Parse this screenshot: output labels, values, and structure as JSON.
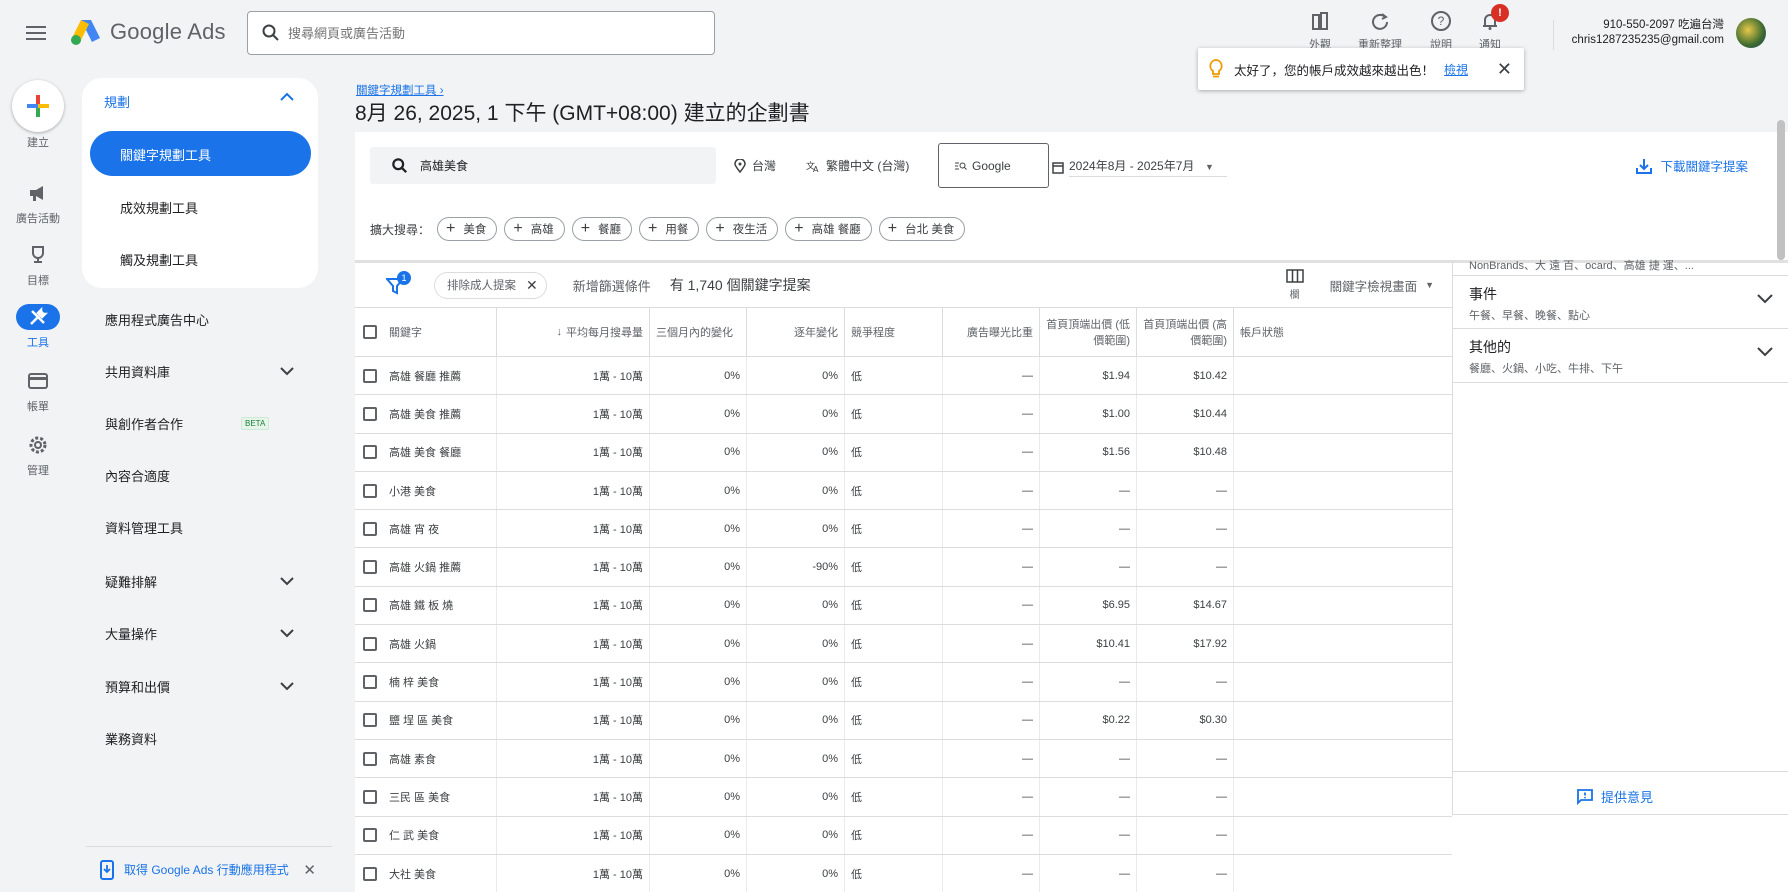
{
  "header": {
    "logo_text": "Google Ads",
    "search_placeholder": "搜尋網頁或廣告活動",
    "tools": [
      {
        "icon": "appearance-icon",
        "label": "外觀"
      },
      {
        "icon": "refresh-icon",
        "label": "重新整理"
      },
      {
        "icon": "help-icon",
        "label": "說明"
      },
      {
        "icon": "bell-icon",
        "label": "通知",
        "badge": "!"
      }
    ],
    "account_line1": "910-550-2097 吃遍台灣",
    "account_line2": "chris1287235235@gmail.com"
  },
  "rail": {
    "create_label": "建立",
    "items": [
      {
        "icon": "megaphone-icon",
        "label": "廣告活動"
      },
      {
        "icon": "trophy-icon",
        "label": "目標"
      },
      {
        "icon": "tools-icon",
        "label": "工具",
        "active": true
      },
      {
        "icon": "billing-icon",
        "label": "帳單"
      },
      {
        "icon": "gear-icon",
        "label": "管理"
      }
    ]
  },
  "nav": {
    "section": "規劃",
    "selected": "關鍵字規劃工具",
    "subitems": [
      "成效規劃工具",
      "觸及規劃工具"
    ],
    "items": [
      {
        "label": "應用程式廣告中心",
        "expandable": false
      },
      {
        "label": "共用資料庫",
        "expandable": true
      },
      {
        "label": "與創作者合作",
        "expandable": false,
        "badge": "BETA"
      },
      {
        "label": "內容合適度",
        "expandable": false
      },
      {
        "label": "資料管理工具",
        "expandable": false
      },
      {
        "label": "疑難排解",
        "expandable": true
      },
      {
        "label": "大量操作",
        "expandable": true
      },
      {
        "label": "預算和出價",
        "expandable": true
      },
      {
        "label": "業務資料",
        "expandable": false
      }
    ],
    "app_promo": "取得 Google Ads 行動應用程式"
  },
  "breadcrumb": "關鍵字規劃工具",
  "page_title": "8月 26, 2025, 1 下午 (GMT+08:00) 建立的企劃書",
  "toast": {
    "message": "太好了，您的帳戶成效越來越出色！",
    "link": "檢視"
  },
  "controls": {
    "keyword": "高雄美食",
    "location": "台灣",
    "language": "繁體中文 (台灣)",
    "network": "Google",
    "date_range": "2024年8月 - 2025年7月",
    "download": "下載關鍵字提案"
  },
  "expand": {
    "label": "擴大搜尋：",
    "chips": [
      "美食",
      "高雄",
      "餐廳",
      "用餐",
      "夜生活",
      "高雄 餐廳",
      "台北 美食"
    ]
  },
  "filters": {
    "filter_count": "1",
    "chip": "排除成人提案",
    "add_filter": "新增篩選條件",
    "result_count": "有 1,740 個關鍵字提案",
    "columns_label": "欄",
    "view_label": "關鍵字檢視畫面"
  },
  "table": {
    "headers": [
      "關鍵字",
      "平均每月搜尋量",
      "三個月內的變化",
      "逐年變化",
      "競爭程度",
      "廣告曝光比重",
      "首頁頂端出價 (低價範圍)",
      "首頁頂端出價 (高價範圍)",
      "帳戶狀態"
    ],
    "rows": [
      [
        "高雄 餐廳 推薦",
        "1萬 - 10萬",
        "0%",
        "0%",
        "低",
        "—",
        "$1.94",
        "$10.42"
      ],
      [
        "高雄 美食 推薦",
        "1萬 - 10萬",
        "0%",
        "0%",
        "低",
        "—",
        "$1.00",
        "$10.44"
      ],
      [
        "高雄 美食 餐廳",
        "1萬 - 10萬",
        "0%",
        "0%",
        "低",
        "—",
        "$1.56",
        "$10.48"
      ],
      [
        "小港 美食",
        "1萬 - 10萬",
        "0%",
        "0%",
        "低",
        "—",
        "—",
        "—"
      ],
      [
        "高雄 宵 夜",
        "1萬 - 10萬",
        "0%",
        "0%",
        "低",
        "—",
        "—",
        "—"
      ],
      [
        "高雄 火鍋 推薦",
        "1萬 - 10萬",
        "0%",
        "-90%",
        "低",
        "—",
        "—",
        "—"
      ],
      [
        "高雄 鐵 板 燒",
        "1萬 - 10萬",
        "0%",
        "0%",
        "低",
        "—",
        "$6.95",
        "$14.67"
      ],
      [
        "高雄 火鍋",
        "1萬 - 10萬",
        "0%",
        "0%",
        "低",
        "—",
        "$10.41",
        "$17.92"
      ],
      [
        "楠 梓 美食",
        "1萬 - 10萬",
        "0%",
        "0%",
        "低",
        "—",
        "—",
        "—"
      ],
      [
        "鹽 埕 區 美食",
        "1萬 - 10萬",
        "0%",
        "0%",
        "低",
        "—",
        "$0.22",
        "$0.30"
      ],
      [
        "高雄 素食",
        "1萬 - 10萬",
        "0%",
        "0%",
        "低",
        "—",
        "—",
        "—"
      ],
      [
        "三民 區 美食",
        "1萬 - 10萬",
        "0%",
        "0%",
        "低",
        "—",
        "—",
        "—"
      ],
      [
        "仁 武 美食",
        "1萬 - 10萬",
        "0%",
        "0%",
        "低",
        "—",
        "—",
        "—"
      ],
      [
        "大社 美食",
        "1萬 - 10萬",
        "0%",
        "0%",
        "低",
        "—",
        "—",
        "—"
      ]
    ]
  },
  "side_panel": {
    "partial_text": "NonBrands、大 遠 百、ocard、高雄 捷 運、...",
    "sections": [
      {
        "title": "事件",
        "subtitle": "午餐、早餐、晚餐、點心"
      },
      {
        "title": "其他的",
        "subtitle": "餐廳、火鍋、小吃、牛排、下午"
      }
    ],
    "feedback": "提供意見"
  },
  "colors": {
    "accent": "#1a73e8",
    "badge": "#d93025"
  }
}
